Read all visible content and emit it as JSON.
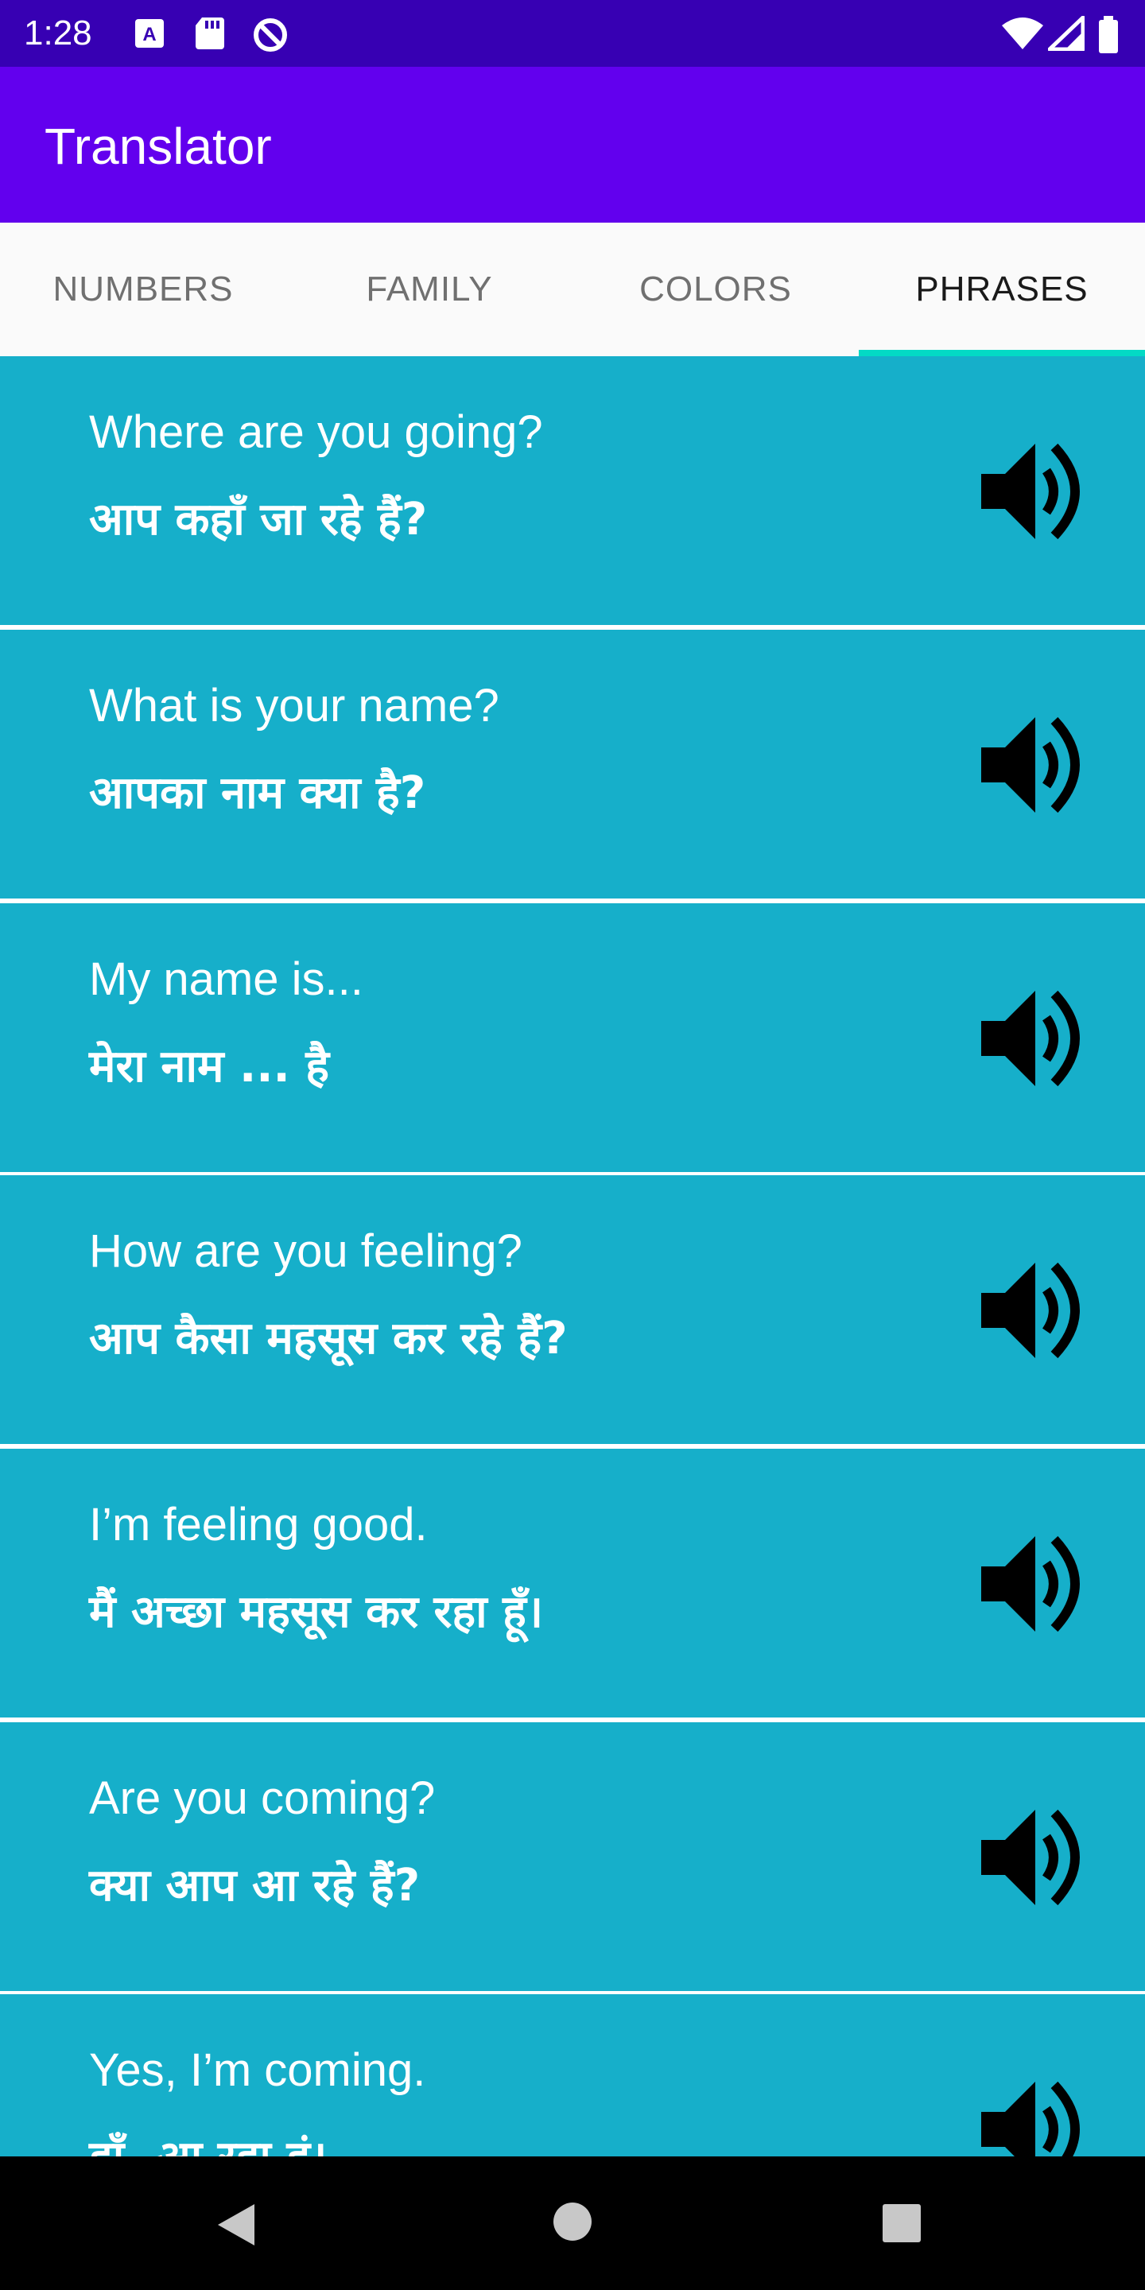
{
  "status_bar": {
    "time": "1:28",
    "icons": [
      "keyboard-a-icon",
      "sd-card-icon",
      "sync-icon",
      "wifi-icon",
      "signal-icon",
      "battery-icon"
    ]
  },
  "app_bar": {
    "title": "Translator"
  },
  "tabs": [
    {
      "label": "NUMBERS",
      "active": false
    },
    {
      "label": "FAMILY",
      "active": false
    },
    {
      "label": "COLORS",
      "active": false
    },
    {
      "label": "PHRASES",
      "active": true
    }
  ],
  "phrases": [
    {
      "english": "Where are you going?",
      "hindi": "आप कहाँ जा रहे हैं?"
    },
    {
      "english": "What is your name?",
      "hindi": "आपका नाम क्या है?"
    },
    {
      "english": "My name is...",
      "hindi": "मेरा नाम ... है"
    },
    {
      "english": "How are you feeling?",
      "hindi": "आप कैसा महसूस कर रहे हैं?"
    },
    {
      "english": "I’m feeling good.",
      "hindi": "मैं अच्छा महसूस कर रहा हूँ।"
    },
    {
      "english": "Are you coming?",
      "hindi": "क्या आप आ रहे हैं?"
    },
    {
      "english": "Yes, I’m coming.",
      "hindi": "हाँ, आ रहा हूं।"
    }
  ],
  "colors": {
    "status_bar": "#3700B3",
    "app_bar": "#6200EE",
    "accent": "#03DAC5",
    "row_background": "#16AFCA"
  },
  "nav_bar": {
    "icons": [
      "back-icon",
      "home-icon",
      "recents-icon"
    ]
  }
}
